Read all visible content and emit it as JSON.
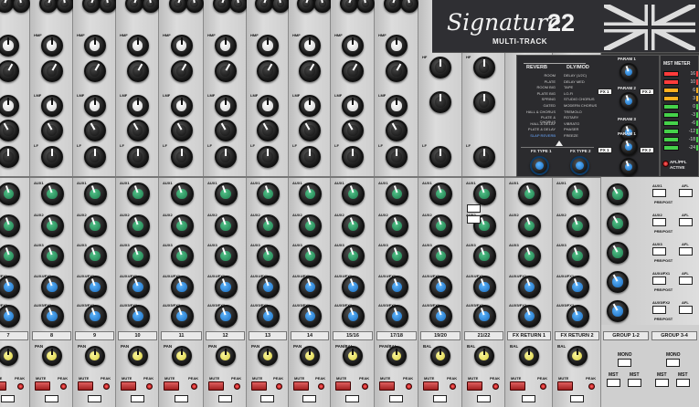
{
  "brand": {
    "name": "Signature",
    "number": "22",
    "subtitle": "MULTI-TRACK"
  },
  "strip_labels": {
    "pan": "PAN",
    "bal": "BAL",
    "hf": "HF",
    "hmf": "HMF",
    "lmf": "LMF",
    "lf": "LF",
    "mute": "MUTE",
    "peak": "PEAK"
  },
  "aux_labels": [
    "AUX1",
    "AUX2",
    "AUX3",
    "AUX4/FX1",
    "AUX5/FX2"
  ],
  "channels": [
    {
      "label": "7",
      "pan_label": "PAN"
    },
    {
      "label": "8",
      "pan_label": "PAN"
    },
    {
      "label": "9",
      "pan_label": "PAN"
    },
    {
      "label": "10",
      "pan_label": "PAN"
    },
    {
      "label": "11",
      "pan_label": "PAN"
    },
    {
      "label": "12",
      "pan_label": "PAN"
    },
    {
      "label": "13",
      "pan_label": "PAN"
    },
    {
      "label": "14",
      "pan_label": "PAN"
    },
    {
      "label": "15/16",
      "pan_label": "PAN/BAL"
    },
    {
      "label": "17/18",
      "pan_label": "PAN/BAL"
    },
    {
      "label": "19/20",
      "pan_label": "BAL"
    },
    {
      "label": "21/22",
      "pan_label": "BAL"
    },
    {
      "label": "FX RETURN 1",
      "pan_label": "BAL"
    },
    {
      "label": "FX RETURN 2",
      "pan_label": "BAL"
    }
  ],
  "fx": {
    "reverb_title": "REVERB",
    "dlymod_title": "DLY/MOD",
    "reverb_presets": [
      "ROOM",
      "PLATE",
      "ROOM BIG",
      "PLATE BIG",
      "SPRING",
      "GATED",
      "HALL & CHORUS",
      "PLATE & CHORUS",
      "HALL & DELAY",
      "PLATE & DELAY",
      "SLAP REVERB"
    ],
    "dlymod_presets": [
      "DELAY (1/2C)",
      "DELAY MED",
      "TAPE",
      "LO-FI",
      "STUDIO CHORUS",
      "MODERN CHORUS",
      "TREMOLO",
      "ROTARY",
      "VIBRATO",
      "PHASER",
      "FREEZE"
    ],
    "param_labels": [
      "PARAM 1",
      "PARAM 2",
      "PARAM 3",
      "PARAM 1",
      "PARAM 2",
      "PARAM 3"
    ],
    "fx1": "FX 1",
    "fx2": "FX 2",
    "fxtype1": "FX TYPE 1",
    "fxtype2": "FX TYPE 2"
  },
  "meter": {
    "title": "MST METER",
    "scale": [
      "16",
      "10",
      "6",
      "3",
      "0",
      "-3",
      "-6",
      "-12",
      "-18",
      "-24"
    ],
    "afl_active": "AFL/PFL ACTIVE",
    "colors": {
      "red": "#ff3b3b",
      "amber": "#ffb020",
      "green": "#45d24a",
      "off": "#1f3f1f"
    }
  },
  "master": {
    "buttons": [
      "AUX1",
      "AFL",
      "AUX2",
      "AFL",
      "AUX3",
      "AFL",
      "AUX4/FX1",
      "AFL",
      "AUX5/FX2",
      "AFL"
    ],
    "prepost": "PRE/POST",
    "groups": [
      "GROUP 1-2",
      "GROUP 3-4"
    ],
    "mono": "MONO",
    "mst": "MST"
  }
}
